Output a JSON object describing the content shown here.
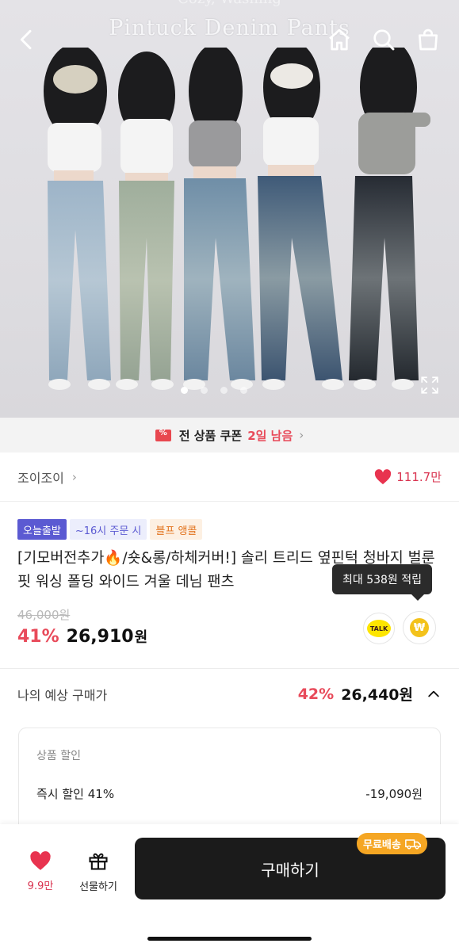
{
  "hero": {
    "title_top": "Cozy, Washing",
    "title": "Pintuck Denim Pants",
    "slide_count": 4,
    "active_slide": 0
  },
  "coupon": {
    "label": "전 상품 쿠폰",
    "remaining": "2일 남음"
  },
  "seller": {
    "name": "조이조이",
    "likes": "111.7만"
  },
  "badges": [
    "오늘출발",
    "~16시 주문 시",
    "블프 앵콜"
  ],
  "product": {
    "title_part1": "[기모버전추가",
    "title_part2": "/숏&롱/하체커버!] 솔리 트리드 옆핀턱 청바지 벌룬핏 워싱 폴딩 와이드 겨울 데님 팬츠",
    "original_price": "46,000원",
    "discount": "41%",
    "price": "26,910",
    "price_unit": "원"
  },
  "tooltip": "최대 538원 적립",
  "buttons": {
    "talk": "TALK",
    "point": "₩"
  },
  "expected": {
    "label": "나의 예상 구매가",
    "discount": "42%",
    "price": "26,440원"
  },
  "breakdown": {
    "header": "상품 할인",
    "rows": [
      {
        "label": "즉시 할인 41%",
        "value": "-19,090원"
      }
    ]
  },
  "bottom": {
    "wish_count": "9.9만",
    "gift_label": "선물하기",
    "buy_label": "구매하기",
    "free_ship": "무료배송"
  },
  "colors": {
    "accent_red": "#e84a5a",
    "heart": "#e8334f",
    "badge_purple": "#5b5ad2",
    "free_ship": "#f5a623",
    "buy_button": "#1b1b1b"
  }
}
